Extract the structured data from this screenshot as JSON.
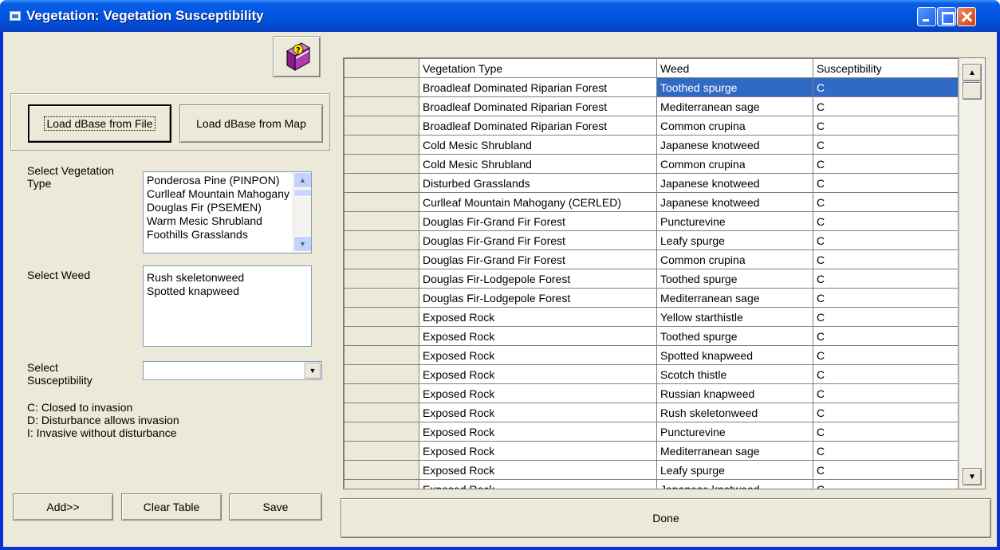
{
  "window": {
    "title": "Vegetation: Vegetation Susceptibility"
  },
  "toolbar": {
    "load_file_label": "Load dBase from File",
    "load_map_label": "Load dBase from Map"
  },
  "vegetation": {
    "label": "Select Vegetation Type",
    "items": [
      "Ponderosa Pine (PINPON)",
      "Curlleaf Mountain Mahogany (CERLED)",
      "Douglas Fir (PSEMEN)",
      "Warm Mesic Shrubland",
      "Foothills Grasslands"
    ]
  },
  "weed": {
    "label": "Select Weed",
    "items": [
      "Rush skeletonweed",
      "Spotted knapweed"
    ]
  },
  "susceptibility": {
    "label": "Select Susceptibility",
    "value": "",
    "legend": [
      "C: Closed to invasion",
      "D: Disturbance allows invasion",
      "I: Invasive without disturbance"
    ]
  },
  "actions": {
    "add_label": "Add>>",
    "clear_label": "Clear Table",
    "save_label": "Save",
    "done_label": "Done"
  },
  "table": {
    "columns": [
      "Vegetation Type",
      "Weed",
      "Susceptibility"
    ],
    "rows": [
      [
        "Broadleaf Dominated Riparian Forest",
        "Toothed spurge",
        "C"
      ],
      [
        "Broadleaf Dominated Riparian Forest",
        "Mediterranean sage",
        "C"
      ],
      [
        "Broadleaf Dominated Riparian Forest",
        "Common crupina",
        "C"
      ],
      [
        "Cold Mesic Shrubland",
        "Japanese knotweed",
        "C"
      ],
      [
        "Cold Mesic Shrubland",
        "Common crupina",
        "C"
      ],
      [
        "Disturbed Grasslands",
        "Japanese knotweed",
        "C"
      ],
      [
        "Curlleaf Mountain Mahogany (CERLED)",
        "Japanese knotweed",
        "C"
      ],
      [
        "Douglas Fir-Grand Fir Forest",
        "Puncturevine",
        "C"
      ],
      [
        "Douglas Fir-Grand Fir Forest",
        "Leafy spurge",
        "C"
      ],
      [
        "Douglas Fir-Grand Fir Forest",
        "Common crupina",
        "C"
      ],
      [
        "Douglas Fir-Lodgepole Forest",
        "Toothed spurge",
        "C"
      ],
      [
        "Douglas Fir-Lodgepole Forest",
        "Mediterranean sage",
        "C"
      ],
      [
        "Exposed Rock",
        "Yellow starthistle",
        "C"
      ],
      [
        "Exposed Rock",
        "Toothed spurge",
        "C"
      ],
      [
        "Exposed Rock",
        "Spotted knapweed",
        "C"
      ],
      [
        "Exposed Rock",
        "Scotch thistle",
        "C"
      ],
      [
        "Exposed Rock",
        "Russian knapweed",
        "C"
      ],
      [
        "Exposed Rock",
        "Rush skeletonweed",
        "C"
      ],
      [
        "Exposed Rock",
        "Puncturevine",
        "C"
      ],
      [
        "Exposed Rock",
        "Mediterranean sage",
        "C"
      ],
      [
        "Exposed Rock",
        "Leafy spurge",
        "C"
      ],
      [
        "Exposed Rock",
        "Japanese knotweed",
        "C"
      ]
    ]
  },
  "icons": {
    "help": "help-book-icon",
    "scroll_up": "arrow-up-icon",
    "scroll_down": "arrow-down-icon"
  }
}
